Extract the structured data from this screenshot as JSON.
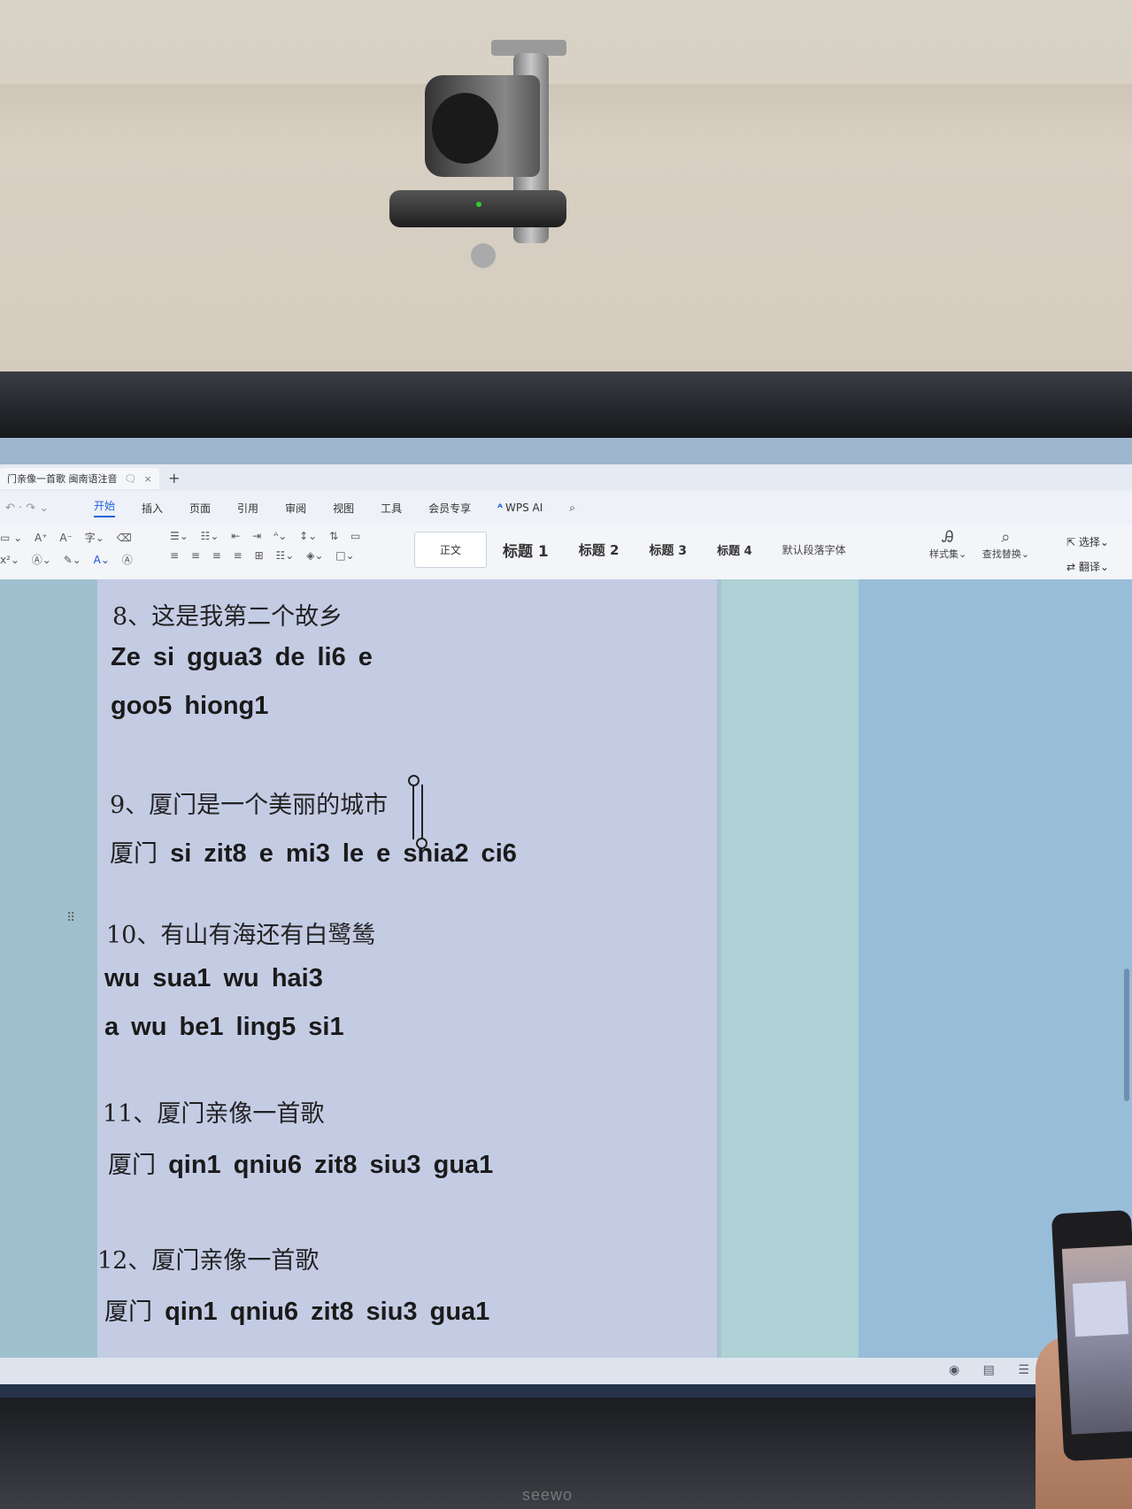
{
  "window": {
    "doc_tab_title": "门亲像一首歌 闽南语注音",
    "new_tab": "+",
    "tabs": [
      "开始",
      "插入",
      "页面",
      "引用",
      "审阅",
      "视图",
      "工具",
      "会员专享"
    ],
    "active_tab": "开始",
    "wps_ai": "WPS AI"
  },
  "toolbar": {
    "styles": [
      "正文",
      "标题 1",
      "标题 2",
      "标题 3",
      "标题 4",
      "默认段落字体"
    ],
    "style_set": "样式集",
    "find_replace": "查找替换",
    "select": "选择",
    "translate": "翻译"
  },
  "document": {
    "lines": [
      {
        "id": "l8",
        "text": "8、这是我第二个故乡"
      },
      {
        "id": "l8a",
        "text": "Ze si   ggua3 de   li6   e"
      },
      {
        "id": "l8b",
        "text": "goo5   hiong1"
      },
      {
        "id": "l9",
        "text": "9、厦门是一个美丽的城市"
      },
      {
        "id": "l9a_cn",
        "text": "厦门"
      },
      {
        "id": "l9a",
        "text": "si zit8 e mi3 le  e   snia2 ci6"
      },
      {
        "id": "l10",
        "text": "10、有山有海还有白鹭鸶"
      },
      {
        "id": "l10a",
        "text": "wu sua1 wu hai3"
      },
      {
        "id": "l10b",
        "text": "a wu   be1 ling5   si1"
      },
      {
        "id": "l11",
        "text": "11、厦门亲像一首歌"
      },
      {
        "id": "l11a_cn",
        "text": "厦门"
      },
      {
        "id": "l11a",
        "text": "qin1 qniu6   zit8 siu3 gua1"
      },
      {
        "id": "l12",
        "text": "12、厦门亲像一首歌"
      },
      {
        "id": "l12a_cn",
        "text": "厦门"
      },
      {
        "id": "l12a",
        "text": "qin1 qniu6   zit8   siu3   gua1"
      }
    ]
  },
  "display": {
    "brand": "seewo"
  }
}
